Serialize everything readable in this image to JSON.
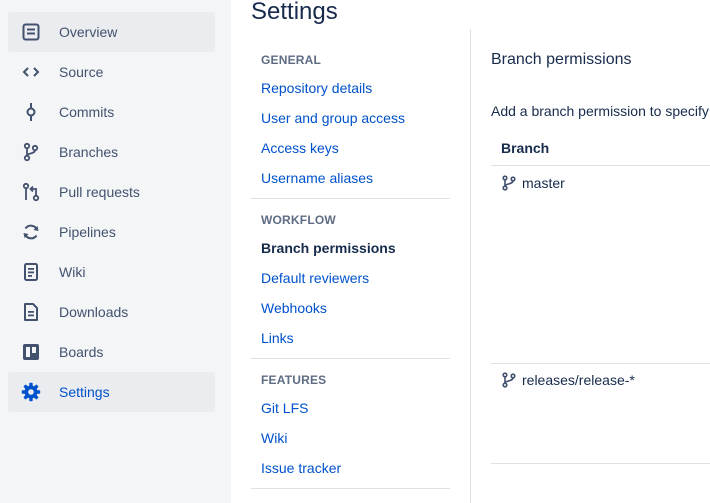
{
  "sidebar": {
    "items": [
      {
        "label": "Overview",
        "icon": "overview-icon"
      },
      {
        "label": "Source",
        "icon": "source-icon"
      },
      {
        "label": "Commits",
        "icon": "commits-icon"
      },
      {
        "label": "Branches",
        "icon": "branches-icon"
      },
      {
        "label": "Pull requests",
        "icon": "pull-requests-icon"
      },
      {
        "label": "Pipelines",
        "icon": "pipelines-icon"
      },
      {
        "label": "Wiki",
        "icon": "wiki-icon"
      },
      {
        "label": "Downloads",
        "icon": "downloads-icon"
      },
      {
        "label": "Boards",
        "icon": "boards-icon"
      },
      {
        "label": "Settings",
        "icon": "gear-icon"
      }
    ]
  },
  "page": {
    "title": "Settings"
  },
  "subnav": {
    "general": {
      "heading": "GENERAL",
      "links": [
        "Repository details",
        "User and group access",
        "Access keys",
        "Username aliases"
      ]
    },
    "workflow": {
      "heading": "WORKFLOW",
      "links": [
        "Branch permissions",
        "Default reviewers",
        "Webhooks",
        "Links"
      ]
    },
    "features": {
      "heading": "FEATURES",
      "links": [
        "Git LFS",
        "Wiki",
        "Issue tracker"
      ]
    }
  },
  "content": {
    "title": "Branch permissions",
    "description": "Add a branch permission to specify",
    "column_header": "Branch",
    "branches": [
      "master",
      "releases/release-*"
    ]
  },
  "colors": {
    "sidebar_bg": "#F4F5F7",
    "active_bg": "#EBECF0",
    "link": "#0052CC",
    "text": "#172B4D",
    "muted": "#5E6C84"
  }
}
